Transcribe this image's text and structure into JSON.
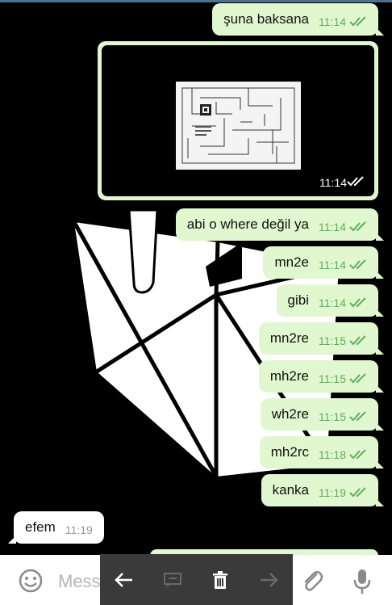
{
  "messages": [
    {
      "dir": "out",
      "text": "şuna baksana",
      "time": "11:14"
    },
    {
      "dir": "out",
      "text": "abi o where değil ya",
      "time": "11:14"
    },
    {
      "dir": "out",
      "text": "mn2e",
      "time": "11:14"
    },
    {
      "dir": "out",
      "text": "gibi",
      "time": "11:14"
    },
    {
      "dir": "out",
      "text": "mn2re",
      "time": "11:15"
    },
    {
      "dir": "out",
      "text": "mh2re",
      "time": "11:15"
    },
    {
      "dir": "out",
      "text": "wh2re",
      "time": "11:15"
    },
    {
      "dir": "out",
      "text": "mh2rc",
      "time": "11:18"
    },
    {
      "dir": "out",
      "text": "kanka",
      "time": "11:19"
    },
    {
      "dir": "in",
      "text": "efem",
      "time": "11:19"
    }
  ],
  "media_message": {
    "time": "11:14",
    "content": "maze-image"
  },
  "input": {
    "placeholder": "Message"
  },
  "toolbar": {
    "icons": [
      "back-arrow-icon",
      "reply-icon",
      "delete-icon",
      "forward-arrow-icon"
    ]
  },
  "colors": {
    "outgoing_bubble": "#e1f7cf",
    "incoming_bubble": "#ffffff",
    "check": "#5fae5a",
    "background": "#000000",
    "toolbar": "#3a3a3a"
  }
}
